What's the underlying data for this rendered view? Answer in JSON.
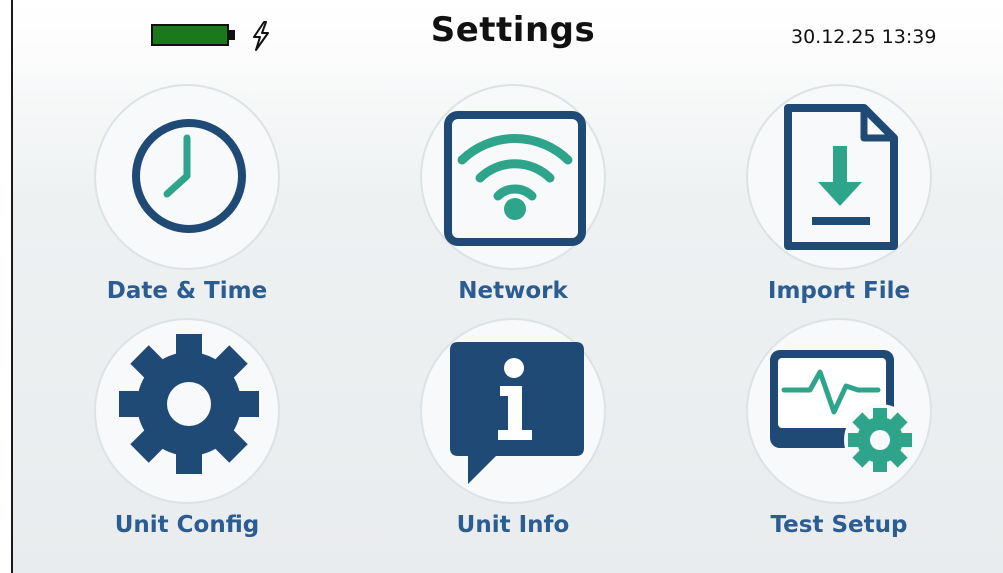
{
  "header": {
    "title": "Settings",
    "datetime": "30.12.25 13:39",
    "battery_level": 1.0,
    "charging": true,
    "battery_color": "#1a7a1a"
  },
  "colors": {
    "icon_primary": "#1f4a75",
    "icon_accent": "#2ea58a",
    "label": "#2b5c92"
  },
  "tiles": [
    {
      "label": "Date & Time",
      "icon": "clock-icon"
    },
    {
      "label": "Network",
      "icon": "wifi-icon"
    },
    {
      "label": "Import File",
      "icon": "import-file-icon"
    },
    {
      "label": "Unit Config",
      "icon": "gear-icon"
    },
    {
      "label": "Unit Info",
      "icon": "info-bubble-icon"
    },
    {
      "label": "Test Setup",
      "icon": "test-setup-icon"
    }
  ]
}
